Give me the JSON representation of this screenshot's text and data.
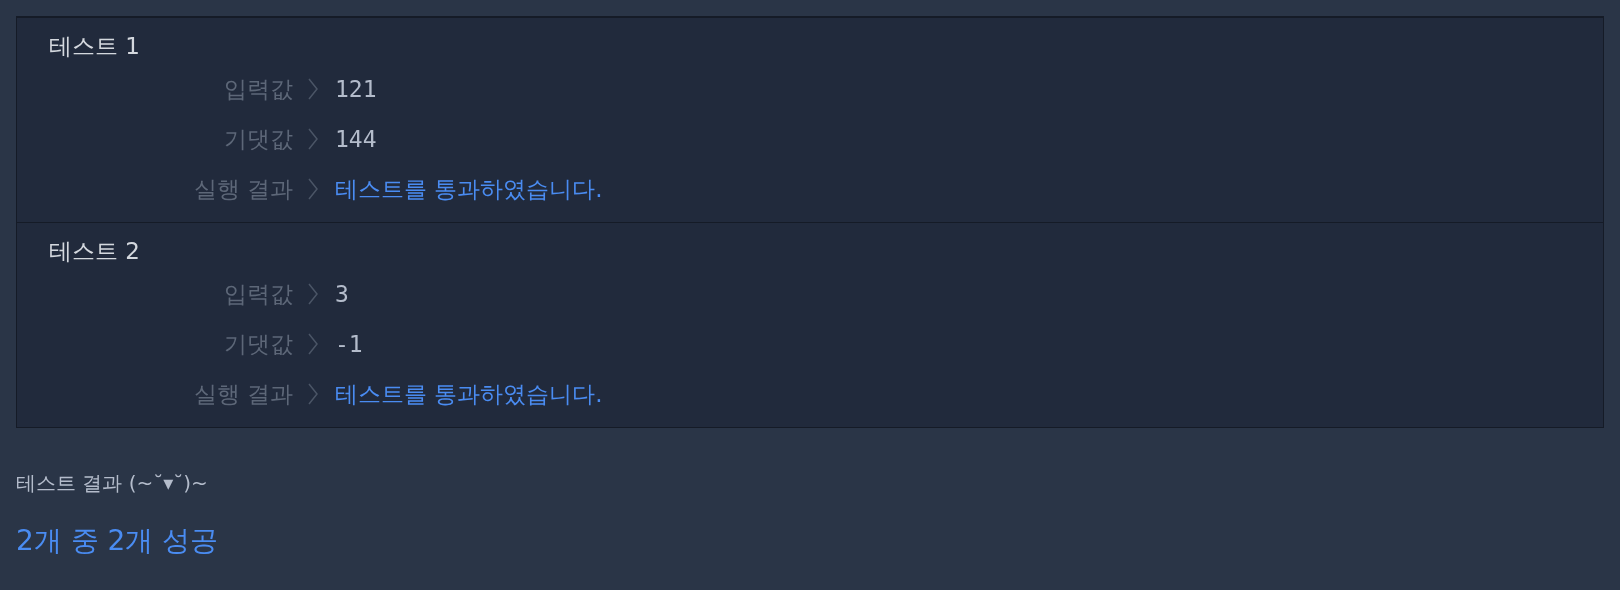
{
  "tests": [
    {
      "title": "테스트 1",
      "rows": [
        {
          "kind": "value",
          "label": "입력값",
          "value": "121"
        },
        {
          "kind": "value",
          "label": "기댓값",
          "value": "144"
        },
        {
          "kind": "result",
          "label": "실행 결과",
          "value": "테스트를 통과하였습니다.",
          "passed": true
        }
      ]
    },
    {
      "title": "테스트 2",
      "rows": [
        {
          "kind": "value",
          "label": "입력값",
          "value": "3"
        },
        {
          "kind": "value",
          "label": "기댓값",
          "value": "-1"
        },
        {
          "kind": "result",
          "label": "실행 결과",
          "value": "테스트를 통과하였습니다.",
          "passed": true
        }
      ]
    }
  ],
  "summary": {
    "heading": "테스트 결과 (~˘▾˘)~",
    "result": "2개 중 2개 성공"
  }
}
